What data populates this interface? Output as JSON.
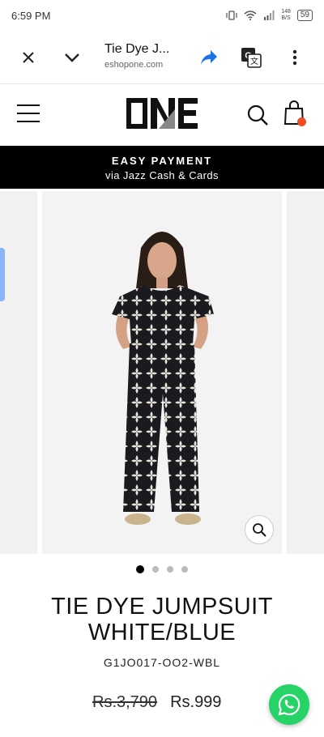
{
  "status_bar": {
    "time": "6:59 PM",
    "net_speed_top": "148",
    "net_speed_bottom": "B/S",
    "battery": "59"
  },
  "browser": {
    "tab_title": "Tie Dye J...",
    "url": "eshopone.com",
    "icons": [
      "close-icon",
      "chevron-down-icon",
      "share-icon",
      "translate-icon",
      "more-vert-icon"
    ]
  },
  "site": {
    "logo_text": "ONE",
    "cart_badge_color": "#f04e23"
  },
  "promo": {
    "line1": "EASY PAYMENT",
    "line2": "via Jazz Cash & Cards"
  },
  "gallery": {
    "slide_count": 4,
    "active_index": 0
  },
  "product": {
    "title_line1": "TIE DYE JUMPSUIT",
    "title_line2": "WHITE/BLUE",
    "sku": "G1JO017-OO2-WBL",
    "price_old": "Rs.3,790",
    "price_new": "Rs.999"
  },
  "colors": {
    "promo_bg": "#000000",
    "whatsapp": "#25d366",
    "browser_share": "#1a73e8"
  }
}
